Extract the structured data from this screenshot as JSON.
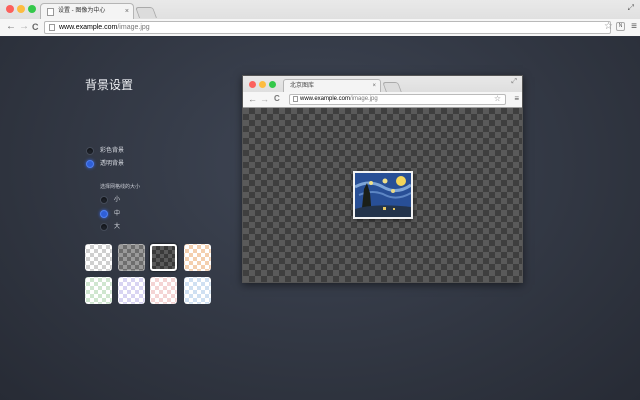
{
  "window": {
    "tab_title": "设置 - 图像为中心",
    "tab_close": "×",
    "url_host": "www.example.com",
    "url_path": "/image.jpg",
    "nav": {
      "back": "←",
      "forward": "→",
      "reload": "C"
    },
    "star": "☆",
    "extension_label": "N",
    "menu": "≡",
    "traffic_colors": [
      "#fc605c",
      "#fdbc40",
      "#34c84a"
    ]
  },
  "settings": {
    "title": "背景设置",
    "bg_options": [
      {
        "label": "彩色背景",
        "checked": false
      },
      {
        "label": "透明背景",
        "checked": true
      }
    ],
    "grid_size_label": "选择网格线的大小",
    "grid_sizes": [
      {
        "label": "小",
        "checked": false
      },
      {
        "label": "中",
        "checked": true
      },
      {
        "label": "大",
        "checked": false
      }
    ],
    "swatches": [
      {
        "name": "light-gray",
        "light": "#ffffff",
        "dark": "#cfcfcf",
        "selected": false
      },
      {
        "name": "mid-gray",
        "light": "#9a9a9a",
        "dark": "#6e6e6e",
        "selected": false
      },
      {
        "name": "dark-gray",
        "light": "#5a5a5a",
        "dark": "#3a3a3a",
        "selected": true
      },
      {
        "name": "peach",
        "light": "#ffffff",
        "dark": "#f4cfae",
        "selected": false
      },
      {
        "name": "mint",
        "light": "#ffffff",
        "dark": "#cfe6cf",
        "selected": false
      },
      {
        "name": "lavender",
        "light": "#ffffff",
        "dark": "#d8d4f2",
        "selected": false
      },
      {
        "name": "pink",
        "light": "#ffffff",
        "dark": "#f4d4d4",
        "selected": false
      },
      {
        "name": "sky",
        "light": "#ffffff",
        "dark": "#cfe0f2",
        "selected": false
      }
    ]
  },
  "preview": {
    "tab_title": "北京图库",
    "tab_close": "×",
    "url_host": "www.example.com",
    "url_path": "/image.jpg",
    "star": "☆",
    "menu": "≡",
    "expand": "⤢"
  },
  "colors": {
    "accent": "#2f5fd8"
  }
}
